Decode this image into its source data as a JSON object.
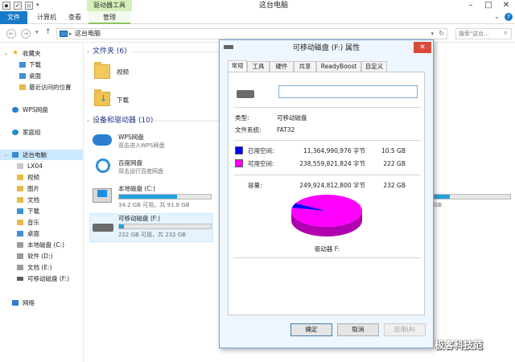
{
  "window": {
    "title": "这台电脑",
    "context_tab_group": "驱动器工具",
    "controls": [
      "–",
      "□",
      "✕"
    ]
  },
  "ribbon": {
    "tabs": [
      "文件",
      "计算机",
      "查看",
      "管理"
    ]
  },
  "address": {
    "path": "这台电脑",
    "search_placeholder": "搜索\"这台..."
  },
  "nav": {
    "favorites": "收藏夹",
    "favorites_items": [
      "下载",
      "桌面",
      "最近访问的位置"
    ],
    "wps": "WPS网盘",
    "homegroup": "家庭组",
    "this_pc": "这台电脑",
    "this_pc_items": [
      "LX04",
      "视频",
      "图片",
      "文档",
      "下载",
      "音乐",
      "桌面",
      "本地磁盘 (C:)",
      "软件 (D:)",
      "文档 (E:)",
      "可移动磁盘 (F:)"
    ],
    "network": "网络"
  },
  "content": {
    "folders_header": "文件夹 (6)",
    "folders": [
      "视频",
      "下载"
    ],
    "devices_header": "设备和驱动器 (10)",
    "devices": [
      {
        "name": "WPS网盘",
        "sub": "双击进入WPS网盘"
      },
      {
        "name": "百度网盘",
        "sub": "双击运行百度网盘"
      },
      {
        "name": "本地磁盘 (C:)",
        "sub": "34.2 GB 可用，共 91.8 GB",
        "used_fraction": 0.63
      },
      {
        "name": "可移动磁盘 (F:)",
        "sub": "222 GB 可用，共 232 GB",
        "used_fraction": 0.05
      }
    ],
    "partial_right": "GB"
  },
  "dialog": {
    "title": "可移动磁盘 (F:) 属性",
    "close": "✕",
    "tabs": [
      "常规",
      "工具",
      "硬件",
      "共享",
      "ReadyBoost",
      "自定义"
    ],
    "name_value": "",
    "type_label": "类型:",
    "type_value": "可移动磁盘",
    "fs_label": "文件系统:",
    "fs_value": "FAT32",
    "used_label": "已用空间:",
    "used_bytes": "11,364,990,976 字节",
    "used_size": "10.5 GB",
    "free_label": "可用空间:",
    "free_bytes": "238,559,821,824 字节",
    "free_size": "222 GB",
    "cap_label": "容量:",
    "cap_bytes": "249,924,812,800 字节",
    "cap_size": "232 GB",
    "drive_label": "驱动器 F:",
    "used_fraction": 0.0455,
    "buttons": {
      "ok": "确定",
      "cancel": "取消",
      "apply": "应用(A)"
    },
    "colors": {
      "used": "#0000ff",
      "free": "#ff00ff"
    }
  },
  "watermark": "极客科技范"
}
